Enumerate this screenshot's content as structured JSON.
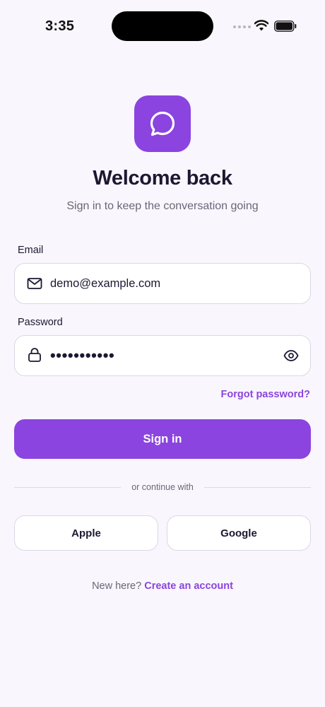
{
  "status_bar": {
    "time": "3:35"
  },
  "header": {
    "title": "Welcome back",
    "subtitle": "Sign in to keep the conversation going"
  },
  "form": {
    "email_label": "Email",
    "email_value": "demo@example.com",
    "password_label": "Password",
    "password_value": "•••••••••••",
    "forgot_label": "Forgot password?",
    "signin_label": "Sign in"
  },
  "divider": {
    "label": "or continue with"
  },
  "social": {
    "apple_label": "Apple",
    "google_label": "Google"
  },
  "footer": {
    "prompt": "New here?",
    "link_label": "Create an account"
  },
  "icons": {
    "logo": "chat-bubble-icon",
    "email": "envelope-icon",
    "password": "lock-icon",
    "reveal": "eye-icon"
  },
  "colors": {
    "accent": "#8b44df",
    "background": "#f9f6fd",
    "border": "#dcd7e6",
    "muted_text": "#6b6678"
  }
}
